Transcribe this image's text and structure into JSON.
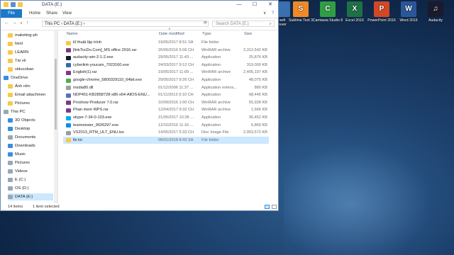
{
  "desktop": {
    "icons": [
      {
        "label": "soft\nrever",
        "color": "#3a6fb0",
        "glyph": ""
      },
      {
        "label": "Sublime Text 3",
        "color": "#f08a24",
        "glyph": "S"
      },
      {
        "label": "Camtasia Studio 8",
        "color": "#2f9e44",
        "glyph": "C"
      },
      {
        "label": "Excel 2016",
        "color": "#1e7145",
        "glyph": "X"
      },
      {
        "label": "PowerPoint 2016",
        "color": "#d24726",
        "glyph": "P"
      },
      {
        "label": "Word 2016",
        "color": "#2b579a",
        "glyph": "W"
      },
      {
        "label": "Audacity",
        "color": "#1a1a2e",
        "glyph": "♫"
      }
    ]
  },
  "window": {
    "title": "DATA (E:)",
    "controls": {
      "minimize": "—",
      "maximize": "☐",
      "close": "✕"
    },
    "ribbon": {
      "file": "File",
      "tabs": [
        "Home",
        "Share",
        "View"
      ],
      "expand": "∨",
      "help": "?"
    },
    "address": {
      "crumbs": "This PC  ›  DATA (E:)  ›",
      "search_placeholder": "Search DATA (E:)"
    },
    "nav": [
      {
        "label": "maketing-ph",
        "icon": "fold",
        "indent": 1
      },
      {
        "label": "html",
        "icon": "fold",
        "indent": 1
      },
      {
        "label": "LEARN",
        "icon": "fold",
        "indent": 1
      },
      {
        "label": "Tài về",
        "icon": "fold",
        "indent": 1
      },
      {
        "label": "viducoban",
        "icon": "fold",
        "indent": 1
      },
      {
        "label": "OneDrive",
        "icon": "blue",
        "indent": 0
      },
      {
        "label": "Ảnh nền",
        "icon": "fold",
        "indent": 1
      },
      {
        "label": "Email attachmen",
        "icon": "fold",
        "indent": 1
      },
      {
        "label": "Pictures",
        "icon": "fold",
        "indent": 1
      },
      {
        "label": "This PC",
        "icon": "drv",
        "indent": 0
      },
      {
        "label": "3D Objects",
        "icon": "blue",
        "indent": 1
      },
      {
        "label": "Desktop",
        "icon": "blue",
        "indent": 1
      },
      {
        "label": "Documents",
        "icon": "drv",
        "indent": 1
      },
      {
        "label": "Downloads",
        "icon": "blue",
        "indent": 1
      },
      {
        "label": "Music",
        "icon": "blue",
        "indent": 1
      },
      {
        "label": "Pictures",
        "icon": "drv",
        "indent": 1
      },
      {
        "label": "Videos",
        "icon": "drv",
        "indent": 1
      },
      {
        "label": "E (C:)",
        "icon": "drv",
        "indent": 1
      },
      {
        "label": "OS (D:)",
        "icon": "drv",
        "indent": 1
      },
      {
        "label": "DATA (E:)",
        "icon": "drv",
        "indent": 1,
        "selected": true
      }
    ],
    "columns": {
      "name": "Name",
      "date": "Date modified",
      "type": "Type",
      "size": "Size"
    },
    "files": [
      {
        "name": "kĩ thuật lập trình",
        "date": "19/05/2017 8:51 SA",
        "type": "File folder",
        "size": "",
        "icon": "#f7c948"
      },
      {
        "name": "[linkTocDo.Com]_MS office 2016.rar",
        "date": "20/06/2016 5:06 CH",
        "type": "WinRAR archive",
        "size": "2,312,542 KB",
        "icon": "#7a3a8a"
      },
      {
        "name": "audacity-win-2-1-2.exe",
        "date": "29/05/2017 11:43 ...",
        "type": "Application",
        "size": "25,876 KB",
        "icon": "#1a1a2e"
      },
      {
        "name": "cyberlink-youcam_7023160.exe",
        "date": "24/03/2017 9:12 CH",
        "type": "Application",
        "size": "319,000 KB",
        "icon": "#2b6cb0"
      },
      {
        "name": "English(1).rar",
        "date": "19/05/2017 11:09 ...",
        "type": "WinRAR archive",
        "size": "2,405,197 KB",
        "icon": "#7a3a8a"
      },
      {
        "name": "google-chrome_5800329110_64bit.exe",
        "date": "29/05/2017 9:26 CH",
        "type": "Application",
        "size": "48,075 KB",
        "icon": "#4caf50"
      },
      {
        "name": "msdia80.dll",
        "date": "01/12/2006 11:37 ...",
        "type": "Application extens...",
        "size": "880 KB",
        "icon": "#9e9e9e"
      },
      {
        "name": "NDP451-KB2858728-x86-x64-AllOS-ENU...",
        "date": "01/11/2013 9:10 CH",
        "type": "Application",
        "size": "68,445 KB",
        "icon": "#5c6bc0"
      },
      {
        "name": "Proshow Producer 7.0.rar",
        "date": "10/09/2016 1:00 CH",
        "type": "WinRAR archive",
        "size": "55,928 KB",
        "icon": "#7a3a8a"
      },
      {
        "name": "Phan mem WPS.rar",
        "date": "12/04/2017 9:32 CH",
        "type": "WinRAR archive",
        "size": "1,666 KB",
        "icon": "#7a3a8a"
      },
      {
        "name": "skype-7-34-0-103.exe",
        "date": "21/05/2017 10:28 ...",
        "type": "Application",
        "size": "36,452 KB",
        "icon": "#00aff0"
      },
      {
        "name": "teamviewer_9026297.exe",
        "date": "12/10/2016 11:16 ...",
        "type": "Application",
        "size": "6,869 KB",
        "icon": "#0e8ee9"
      },
      {
        "name": "VS2013_RTM_ULT_ENU.iso",
        "date": "14/05/2017 5:33 CH",
        "type": "Disc Image File",
        "size": "2,953,572 KB",
        "icon": "#9e9e9e"
      },
      {
        "name": "fix loi",
        "date": "08/01/2018 8:43 SA",
        "type": "File folder",
        "size": "",
        "icon": "#f7c948",
        "selected": true
      }
    ],
    "status": {
      "count": "14 items",
      "selected": "1 item selected"
    }
  }
}
